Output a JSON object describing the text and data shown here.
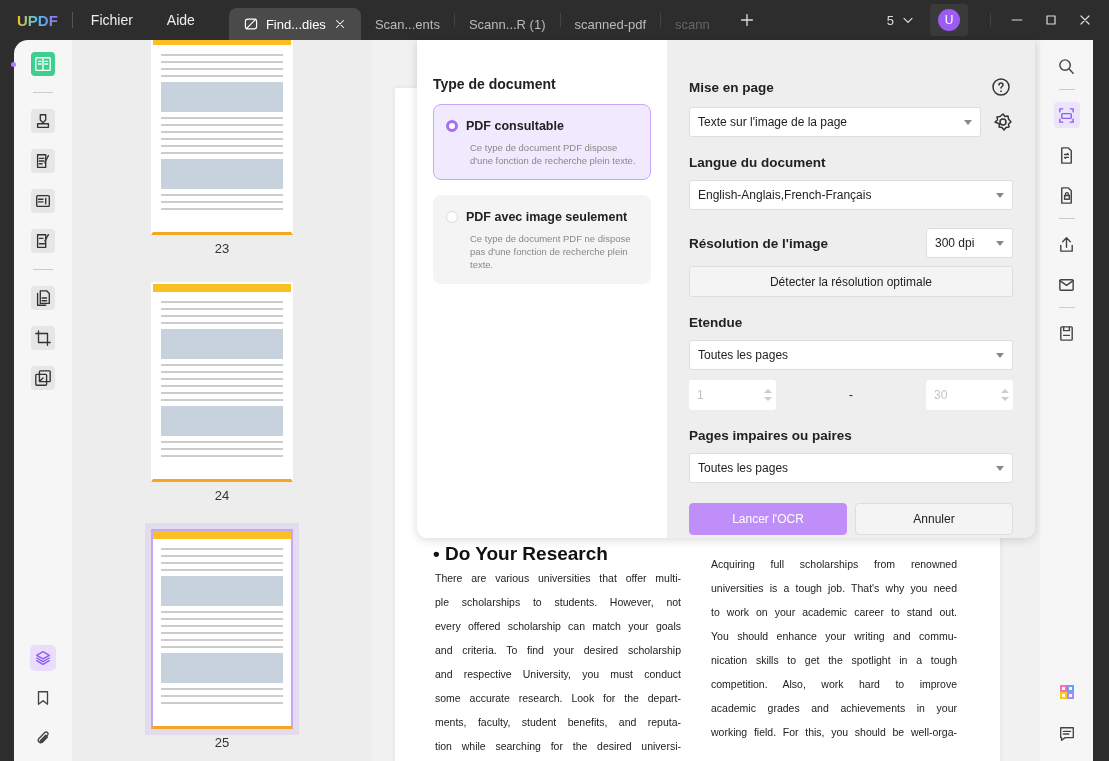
{
  "app": {
    "logo": "UPDF",
    "menu": [
      {
        "label": "Fichier"
      },
      {
        "label": "Aide"
      }
    ]
  },
  "tabs": [
    {
      "label": "Find...dies",
      "selected": true
    },
    {
      "label": "Scan...ents",
      "selected": false
    },
    {
      "label": "Scann...R (1)",
      "selected": false
    },
    {
      "label": "scanned-pdf",
      "selected": false
    },
    {
      "label": "scann",
      "selected": false
    }
  ],
  "tab_count": "5",
  "avatar": "U",
  "left_tools": [
    {
      "selected": true
    },
    {
      "selected": false
    },
    {
      "selected": false
    },
    {
      "selected": false
    },
    {
      "selected": false
    },
    {
      "selected": false
    },
    {
      "selected": false
    },
    {
      "selected": false
    }
  ],
  "left_bottom_tools": [
    {
      "selected": true
    },
    {
      "selected": false
    },
    {
      "selected": false
    }
  ],
  "thumbnails": [
    {
      "page": "23",
      "selected": false
    },
    {
      "page": "24",
      "selected": false
    },
    {
      "page": "25",
      "selected": true
    }
  ],
  "ocr_dialog": {
    "document_type": {
      "title": "Type de document",
      "options": [
        {
          "label": "PDF consultable",
          "description": "Ce type de document PDF dispose d'une fonction de recherche plein texte.",
          "selected": true
        },
        {
          "label": "PDF avec image seulement",
          "description": "Ce type de document PDF ne dispose pas d'une fonction de recherche plein texte.",
          "selected": false
        }
      ]
    },
    "layout": {
      "label": "Mise en page",
      "value": "Texte sur l'image de la page"
    },
    "language": {
      "label": "Langue du document",
      "value": "English-Anglais,French-Français"
    },
    "resolution": {
      "label": "Résolution de l'image",
      "value": "300 dpi",
      "detect_button": "Détecter la résolution optimale"
    },
    "range": {
      "label": "Etendue",
      "value": "Toutes les pages",
      "from": "1",
      "separator": "-",
      "to": "30",
      "disabled": true
    },
    "parity": {
      "label": "Pages impaires ou paires",
      "value": "Toutes les pages"
    },
    "buttons": [
      {
        "label": "Lancer l'OCR",
        "kind": "primary"
      },
      {
        "label": "Annuler",
        "kind": "secondary"
      }
    ]
  },
  "document": {
    "heading": "• Do Your Research",
    "left_lines": [
      "There are various universities that offer multi-",
      "ple scholarships to students. However, not",
      "every offered scholarship can match your goals",
      "and criteria. To find your desired scholarship",
      "and respective University, you must conduct",
      "some accurate research. Look for the depart-",
      "ments, faculty, student benefits, and reputa-",
      "tion while searching for the desired universi-"
    ],
    "right_lines": [
      "Acquiring full scholarships from renowned",
      "universities is a tough job. That's why you need",
      "to work on your academic career to stand out.",
      "You should enhance your writing and commu-",
      "nication skills to get the spotlight in a tough",
      "competition. Also, work hard to improve",
      "academic grades and achievements in your",
      "working field. For this, you should be well-orga-"
    ]
  },
  "right_tools": [
    {
      "selected": false
    },
    {
      "selected": true
    },
    {
      "selected": false
    },
    {
      "selected": false
    },
    {
      "selected": false
    },
    {
      "selected": false
    },
    {
      "selected": false
    }
  ]
}
